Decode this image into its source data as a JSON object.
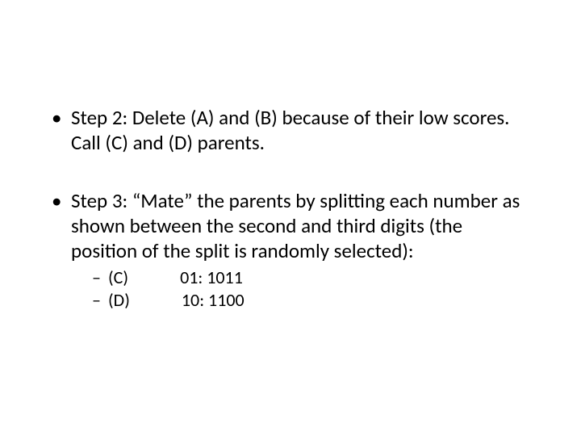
{
  "bullets": {
    "step2": "Step 2: Delete (A) and (B) because of their low scores. Call (C) and (D) parents.",
    "step3": "Step 3: “Mate” the parents by splitting each number as shown between the second and third digits (the position of the split is randomly selected):",
    "sub": {
      "c_label": "(C)",
      "c_value": "01: 1011",
      "d_label": "(D)",
      "d_value": "10: 1100"
    }
  }
}
